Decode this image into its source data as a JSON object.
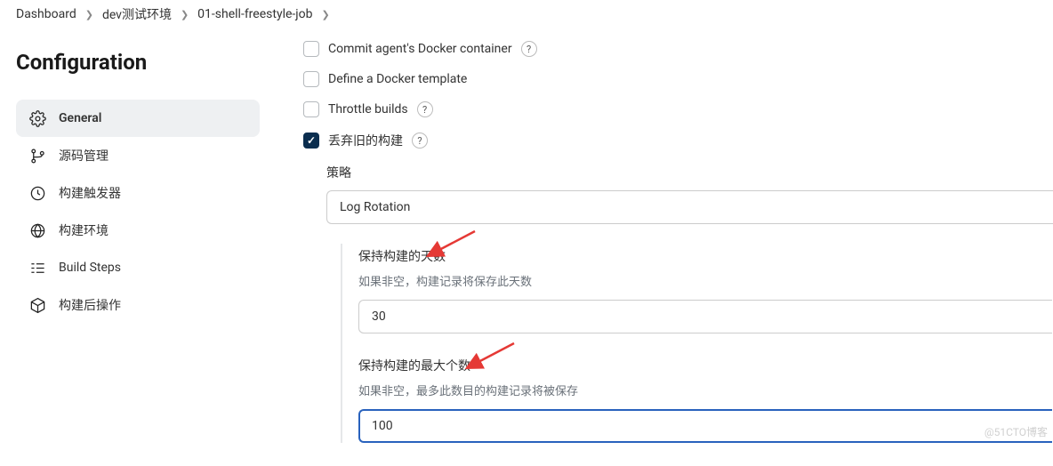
{
  "breadcrumb": {
    "items": [
      "Dashboard",
      "dev测试环境",
      "01-shell-freestyle-job"
    ]
  },
  "page": {
    "title": "Configuration"
  },
  "sidebar": {
    "items": [
      {
        "label": "General"
      },
      {
        "label": "源码管理"
      },
      {
        "label": "构建触发器"
      },
      {
        "label": "构建环境"
      },
      {
        "label": "Build Steps"
      },
      {
        "label": "构建后操作"
      }
    ]
  },
  "options": {
    "commit_docker": "Commit agent's Docker container",
    "define_docker_template": "Define a Docker template",
    "throttle_builds": "Throttle builds",
    "discard_old": "丢弃旧的构建"
  },
  "strategy": {
    "header": "策略",
    "selected": "Log Rotation"
  },
  "days": {
    "label": "保持构建的天数",
    "hint": "如果非空，构建记录将保存此天数",
    "value": "30"
  },
  "max": {
    "label": "保持构建的最大个数",
    "hint": "如果非空，最多此数目的构建记录将被保存",
    "value": "100"
  },
  "help_glyph": "?",
  "watermark": "@51CTO博客"
}
